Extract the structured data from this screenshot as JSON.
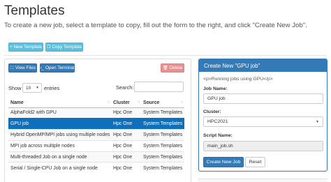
{
  "header": {
    "title": "Templates",
    "subtitle": "To create a new job, select a template to copy, fill out the form to the right, and click \"Create New Job\"."
  },
  "top_actions": {
    "new_template": "+ New Template",
    "copy_template": "Copy Template"
  },
  "panel_actions": {
    "view_files": "View Files",
    "open_terminal": "Open Terminal",
    "delete": "Delete"
  },
  "table_controls": {
    "show_label": "Show",
    "entries_value": "10",
    "entries_label": "entries",
    "search_label": "Search:"
  },
  "table": {
    "columns": [
      "Name",
      "Cluster",
      "Source"
    ],
    "rows": [
      {
        "name": "AlphaFold2 with GPU",
        "cluster": "Hpc One",
        "source": "System Templates"
      },
      {
        "name": "GPU job",
        "cluster": "Hpc One",
        "source": "System Templates"
      },
      {
        "name": "Hybrid OpenMP/MPI jobs using multiple nodes",
        "cluster": "Hpc One",
        "source": "System Templates"
      },
      {
        "name": "MPI job across multiple nodes",
        "cluster": "Hpc One",
        "source": "System Templates"
      },
      {
        "name": "Multi-threaded Job on a single node",
        "cluster": "Hpc One",
        "source": "System Templates"
      },
      {
        "name": "Serial / Single-CPU Job on a single node",
        "cluster": "Hpc One",
        "source": "System Templates"
      }
    ],
    "selected_index": 1
  },
  "create_form": {
    "header": "Create New \"GPU job\"",
    "description": "<p>Running jobs using GPU</p>",
    "job_name_label": "Job Name:",
    "job_name_value": "GPU job",
    "cluster_label": "Cluster:",
    "cluster_value": "HPC2021",
    "script_name_label": "Script Name:",
    "script_name_value": "main_job.sh",
    "create_button": "Create New Job",
    "reset_button": "Reset"
  },
  "colors": {
    "primary": "#337ab7",
    "info": "#5bc0de",
    "selected_row": "#0e6fbd",
    "danger_disabled": "#e8918e"
  }
}
